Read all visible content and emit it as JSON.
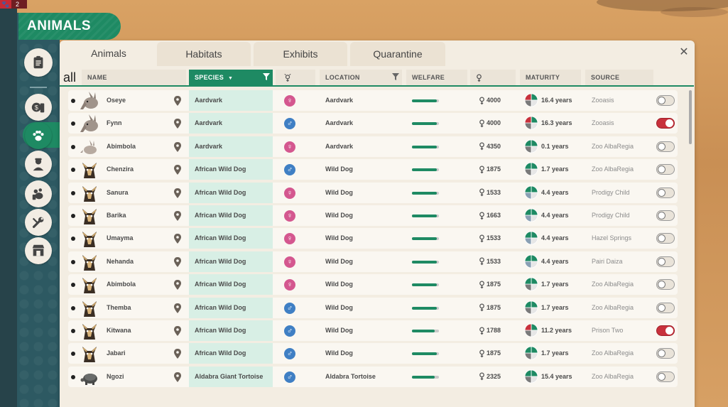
{
  "notification": {
    "count": "2"
  },
  "title": "ANIMALS",
  "tabs": [
    {
      "label": "Animals",
      "active": true
    },
    {
      "label": "Habitats",
      "active": false
    },
    {
      "label": "Exhibits",
      "active": false
    },
    {
      "label": "Quarantine",
      "active": false
    }
  ],
  "close_glyph": "✕",
  "sidebar": [
    {
      "icon": "clipboard-icon"
    },
    {
      "icon": "money-icon"
    },
    {
      "icon": "paw-icon",
      "active": true
    },
    {
      "icon": "zookeeper-icon"
    },
    {
      "icon": "animal-care-icon"
    },
    {
      "icon": "maintenance-icon"
    },
    {
      "icon": "shop-icon"
    }
  ],
  "columns": {
    "all": "all",
    "name": "NAME",
    "species": "SPECIES",
    "location": "LOCATION",
    "welfare": "WELFARE",
    "maturity": "MATURITY",
    "source": "SOURCE"
  },
  "colors": {
    "accent": "#1e8a63",
    "female": "#d4578f",
    "male": "#3f7fc4",
    "toggle_on": "#c8313c"
  },
  "rows": [
    {
      "name": "Oseye",
      "avatar": "aardvark",
      "species": "Aardvark",
      "gender": "female",
      "location": "Aardvark",
      "welfare": 0.92,
      "value": "4000",
      "maturity": "16.4 years",
      "pie": "old",
      "source": "Zooasis",
      "toggle": false
    },
    {
      "name": "Fynn",
      "avatar": "aardvark",
      "species": "Aardvark",
      "gender": "male",
      "location": "Aardvark",
      "welfare": 0.92,
      "value": "4000",
      "maturity": "16.3 years",
      "pie": "old",
      "source": "Zooasis",
      "toggle": true
    },
    {
      "name": "Abimbola",
      "avatar": "aardvark-baby",
      "species": "Aardvark",
      "gender": "female",
      "location": "Aardvark",
      "welfare": 0.92,
      "value": "4350",
      "maturity": "0.1 years",
      "pie": "young",
      "source": "Zoo AlbaRegia",
      "toggle": false
    },
    {
      "name": "Chenzira",
      "avatar": "wild-dog",
      "species": "African Wild Dog",
      "gender": "male",
      "location": "Wild Dog",
      "welfare": 0.92,
      "value": "1875",
      "maturity": "1.7 years",
      "pie": "young",
      "source": "Zoo AlbaRegia",
      "toggle": false
    },
    {
      "name": "Sanura",
      "avatar": "wild-dog",
      "species": "African Wild Dog",
      "gender": "female",
      "location": "Wild Dog",
      "welfare": 0.92,
      "value": "1533",
      "maturity": "4.4 years",
      "pie": "adult",
      "source": "Prodigy Child",
      "toggle": false
    },
    {
      "name": "Barika",
      "avatar": "wild-dog",
      "species": "African Wild Dog",
      "gender": "female",
      "location": "Wild Dog",
      "welfare": 0.92,
      "value": "1663",
      "maturity": "4.4 years",
      "pie": "adult",
      "source": "Prodigy Child",
      "toggle": false
    },
    {
      "name": "Umayma",
      "avatar": "wild-dog",
      "species": "African Wild Dog",
      "gender": "female",
      "location": "Wild Dog",
      "welfare": 0.92,
      "value": "1533",
      "maturity": "4.4 years",
      "pie": "adult",
      "source": "Hazel Springs",
      "toggle": false
    },
    {
      "name": "Nehanda",
      "avatar": "wild-dog",
      "species": "African Wild Dog",
      "gender": "female",
      "location": "Wild Dog",
      "welfare": 0.92,
      "value": "1533",
      "maturity": "4.4 years",
      "pie": "adult",
      "source": "Pairi Daiza",
      "toggle": false
    },
    {
      "name": "Abimbola",
      "avatar": "wild-dog",
      "species": "African Wild Dog",
      "gender": "female",
      "location": "Wild Dog",
      "welfare": 0.92,
      "value": "1875",
      "maturity": "1.7 years",
      "pie": "young",
      "source": "Zoo AlbaRegia",
      "toggle": false
    },
    {
      "name": "Themba",
      "avatar": "wild-dog",
      "species": "African Wild Dog",
      "gender": "male",
      "location": "Wild Dog",
      "welfare": 0.92,
      "value": "1875",
      "maturity": "1.7 years",
      "pie": "young",
      "source": "Zoo AlbaRegia",
      "toggle": false
    },
    {
      "name": "Kitwana",
      "avatar": "wild-dog",
      "species": "African Wild Dog",
      "gender": "male",
      "location": "Wild Dog",
      "welfare": 0.85,
      "value": "1788",
      "maturity": "11.2 years",
      "pie": "old",
      "source": "Prison Two",
      "toggle": true
    },
    {
      "name": "Jabari",
      "avatar": "wild-dog",
      "species": "African Wild Dog",
      "gender": "male",
      "location": "Wild Dog",
      "welfare": 0.92,
      "value": "1875",
      "maturity": "1.7 years",
      "pie": "young",
      "source": "Zoo AlbaRegia",
      "toggle": false
    },
    {
      "name": "Ngozi",
      "avatar": "tortoise",
      "species": "Aldabra Giant Tortoise",
      "gender": "male",
      "location": "Aldabra Tortoise",
      "welfare": 0.85,
      "value": "2325",
      "maturity": "15.4 years",
      "pie": "young",
      "source": "Zoo AlbaRegia",
      "toggle": false
    }
  ]
}
